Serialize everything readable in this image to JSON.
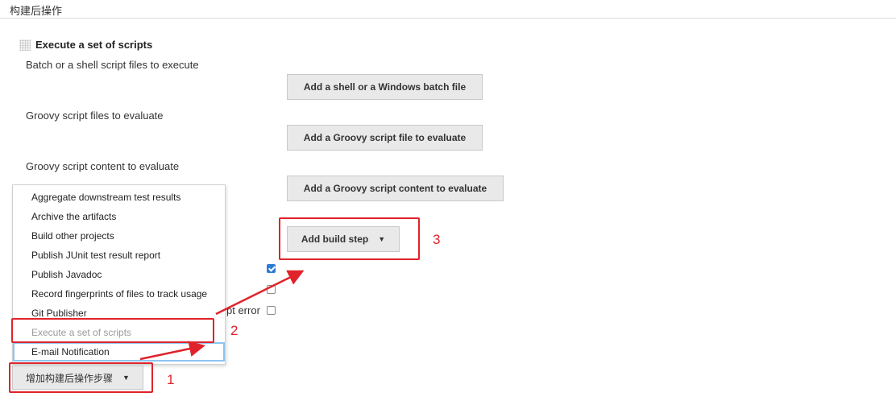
{
  "section": {
    "title": "构建后操作"
  },
  "block": {
    "title": "Execute a set of scripts"
  },
  "fields": [
    {
      "label": "Batch or a shell script files to execute",
      "button": "Add a shell or a Windows batch file"
    },
    {
      "label": "Groovy script files to evaluate",
      "button": "Add a Groovy script file to evaluate"
    },
    {
      "label": "Groovy script content to evaluate",
      "button": "Add a Groovy script content to evaluate"
    }
  ],
  "add_build_step": {
    "label": "Add build step",
    "caret": "▼"
  },
  "checkboxes": {
    "partial_label": "pt error",
    "states": [
      true,
      false,
      false
    ]
  },
  "dropdown": {
    "items": [
      "Aggregate downstream test results",
      "Archive the artifacts",
      "Build other projects",
      "Publish JUnit test result report",
      "Publish Javadoc",
      "Record fingerprints of files to track usage",
      "Git Publisher",
      "Execute a set of scripts",
      "E-mail Notification"
    ]
  },
  "add_post_build_button": {
    "label": "增加构建后操作步骤",
    "caret": "▼"
  },
  "annotations": {
    "n1": "1",
    "n2": "2",
    "n3": "3",
    "color": "#e0232b"
  }
}
